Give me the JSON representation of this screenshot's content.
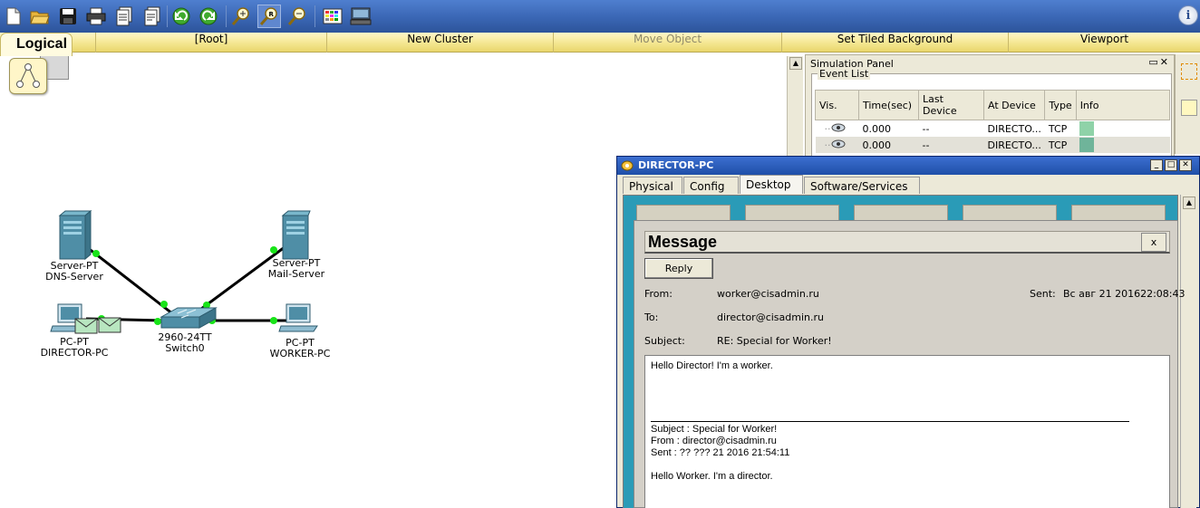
{
  "toolbar": {
    "buttons": [
      "new-icon",
      "open-icon",
      "save-icon",
      "print-icon",
      "activity-wizard-icon",
      "custom-pdu-icon",
      "undo-icon",
      "redo-icon",
      "zoom-in-icon",
      "zoom-reset-icon",
      "zoom-out-icon",
      "palette-icon",
      "custom-device-icon"
    ],
    "info_label": "i"
  },
  "logical_bar": {
    "tab_label": "Logical",
    "items": [
      "[Root]",
      "New Cluster",
      "Move Object",
      "Set Tiled Background",
      "Viewport"
    ]
  },
  "devices": {
    "dns_server": {
      "type": "Server-PT",
      "name": "DNS-Server"
    },
    "mail_server": {
      "type": "Server-PT",
      "name": "Mail-Server"
    },
    "director_pc": {
      "type": "PC-PT",
      "name": "DIRECTOR-PC"
    },
    "worker_pc": {
      "type": "PC-PT",
      "name": "WORKER-PC"
    },
    "switch": {
      "type": "2960-24TT",
      "name": "Switch0"
    }
  },
  "simulation_panel": {
    "title": "Simulation Panel",
    "event_list_label": "Event List",
    "columns": [
      "Vis.",
      "Time(sec)",
      "Last Device",
      "At Device",
      "Type",
      "Info"
    ],
    "rows": [
      {
        "time": "0.000",
        "last_device": "--",
        "at_device": "DIRECTO...",
        "type": "TCP",
        "color": "#8fd2a8"
      },
      {
        "time": "0.000",
        "last_device": "--",
        "at_device": "DIRECTO...",
        "type": "TCP",
        "color": "#6fb49a"
      }
    ]
  },
  "pc_window": {
    "title": "DIRECTOR-PC",
    "tabs": [
      "Physical",
      "Config",
      "Desktop",
      "Software/Services"
    ],
    "active_tab": "Desktop"
  },
  "message": {
    "heading": "Message",
    "close_label": "x",
    "reply_label": "Reply",
    "from_label": "From:",
    "from_value": "worker@cisadmin.ru",
    "sent_label": "Sent:",
    "sent_value": "Вс авг 21 201622:08:43",
    "to_label": "To:",
    "to_value": "director@cisadmin.ru",
    "subject_label": "Subject:",
    "subject_value": "RE: Special for Worker!",
    "body": {
      "reply_text": "Hello Director! I'm a worker.",
      "quoted_subject": "Subject : Special for Worker!",
      "quoted_from": "From : director@cisadmin.ru",
      "quoted_sent": "Sent : ?? ??? 21 2016 21:54:11",
      "quoted_text": "Hello Worker. I'm a director."
    }
  }
}
